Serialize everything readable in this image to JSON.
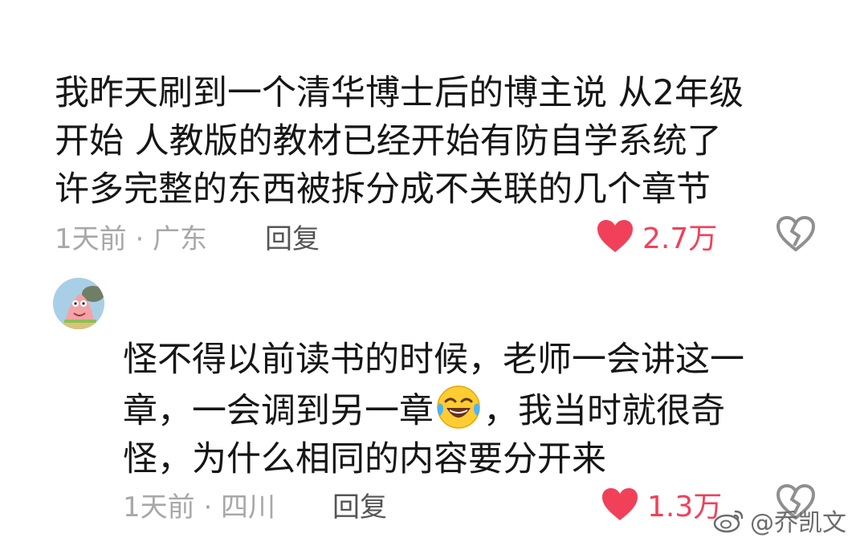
{
  "comments": [
    {
      "lines": [
        "我昨天刷到一个清华博士后的博主说  从2年级",
        "开始  人教版的教材已经开始有防自学系统了",
        "许多完整的东西被拆分成不关联的几个章节"
      ],
      "meta": "1天前 · 广东",
      "reply_label": "回复",
      "likes": "2.7万"
    },
    {
      "lines_before_emoji": [
        "怪不得以前读书的时候，老师一会讲这一"
      ],
      "line2_pre": "章，一会调到另一章",
      "line2_post": "，我当时就很奇",
      "lines_after": [
        "怪，为什么相同的内容要分开来"
      ],
      "meta": "1天前 · 四川",
      "reply_label": "回复",
      "likes": "1.3万"
    }
  ],
  "watermark": "@乔凯文",
  "colors": {
    "like": "#f1415a",
    "meta": "#a8a8a8",
    "reply": "#555555",
    "text": "#161616"
  },
  "icons": [
    "heart-icon",
    "broken-heart-icon",
    "avatar",
    "laughing-tears-emoji",
    "weibo-logo-icon"
  ]
}
